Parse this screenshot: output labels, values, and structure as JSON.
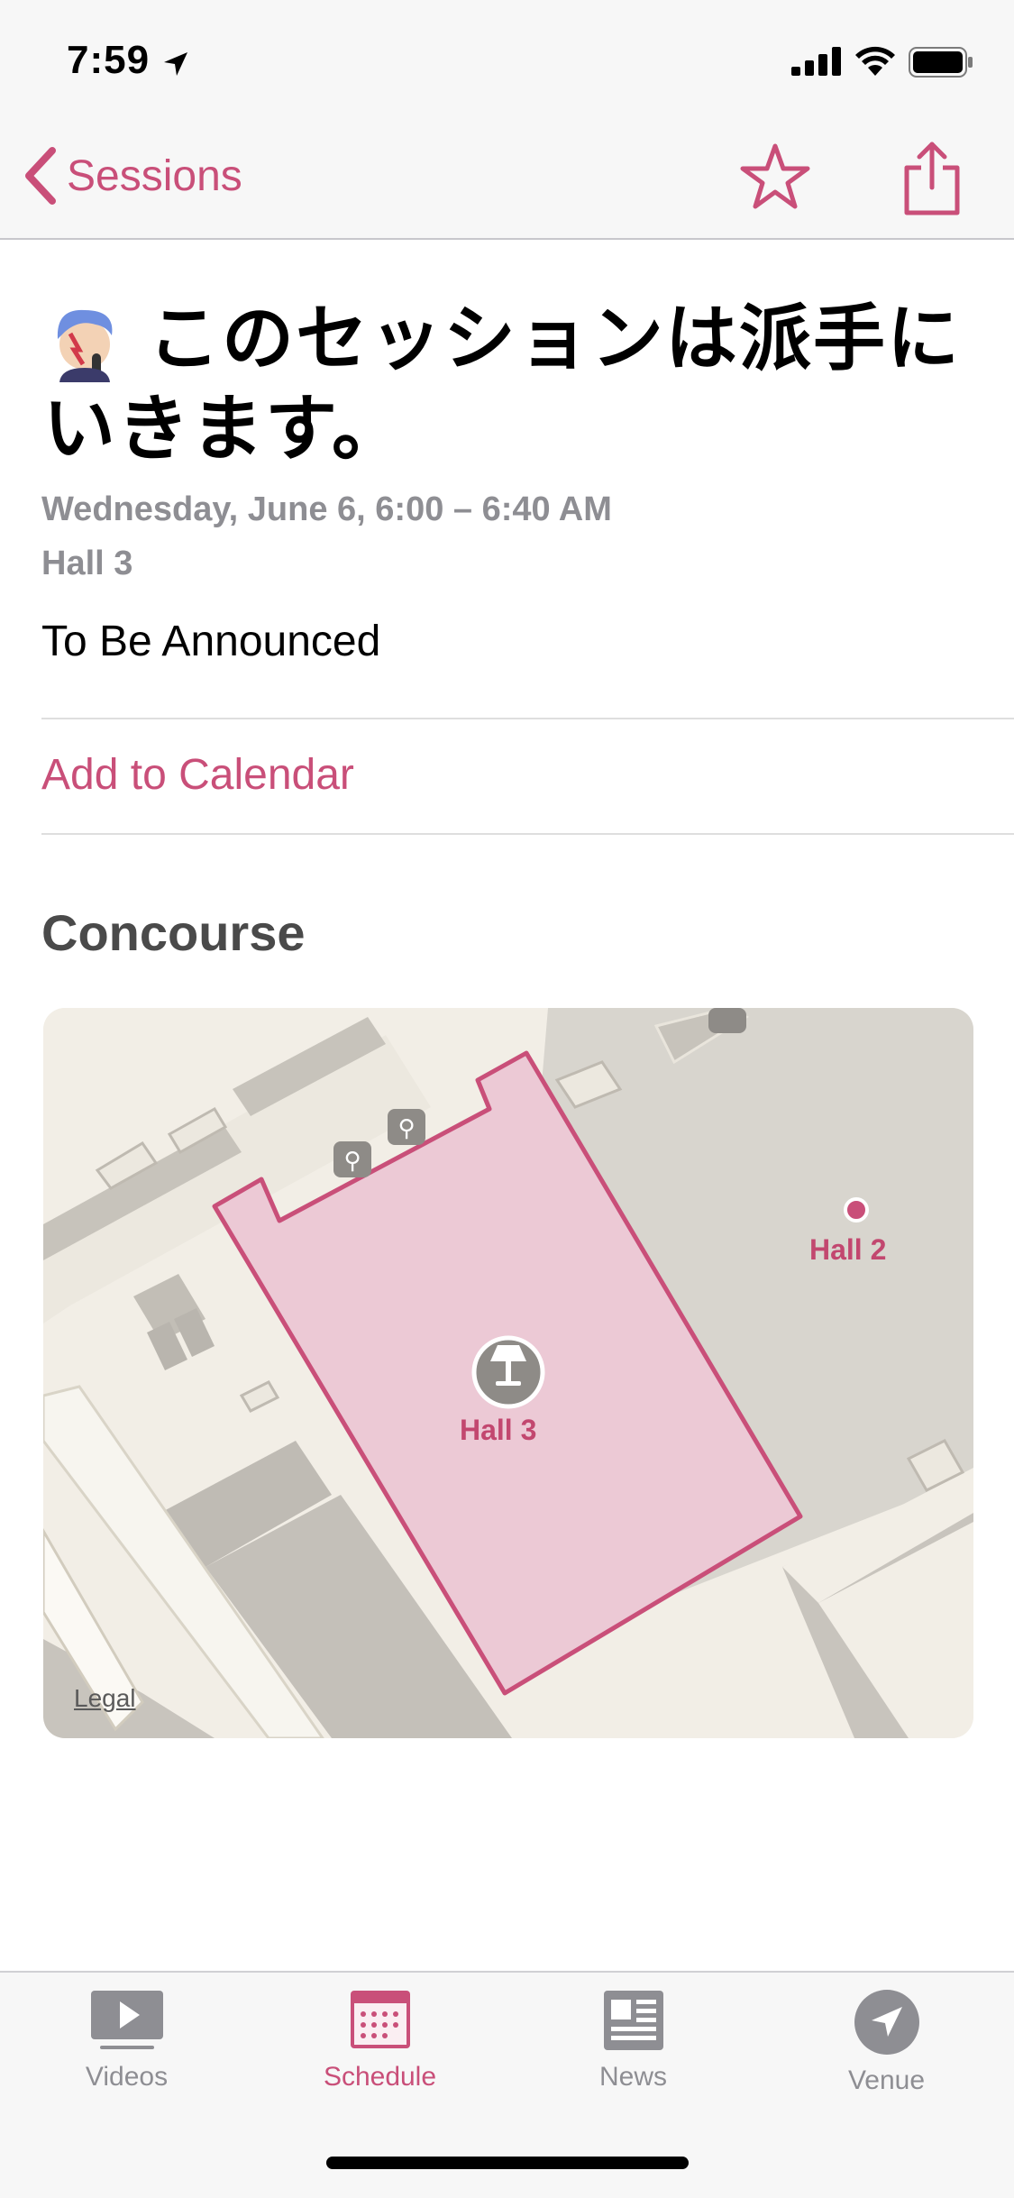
{
  "status_bar": {
    "time": "7:59"
  },
  "nav": {
    "back_label": "Sessions"
  },
  "session": {
    "title": "このセッションは派手にいきます。",
    "date_time": "Wednesday, June 6, 6:00 – 6:40 AM",
    "room": "Hall 3",
    "description": "To Be Announced"
  },
  "actions": {
    "add_to_calendar": "Add to Calendar"
  },
  "map_section": {
    "title": "Concourse",
    "legal_label": "Legal",
    "hall3_label": "Hall 3",
    "hall2_label": "Hall 2"
  },
  "tabs": [
    {
      "label": "Videos",
      "icon": "video-icon",
      "active": false
    },
    {
      "label": "Schedule",
      "icon": "calendar-icon",
      "active": true
    },
    {
      "label": "News",
      "icon": "news-icon",
      "active": false
    },
    {
      "label": "Venue",
      "icon": "location-arrow-icon",
      "active": false
    }
  ],
  "colors": {
    "accent": "#c94f79",
    "highlight_fill": "#ecc9d5"
  }
}
